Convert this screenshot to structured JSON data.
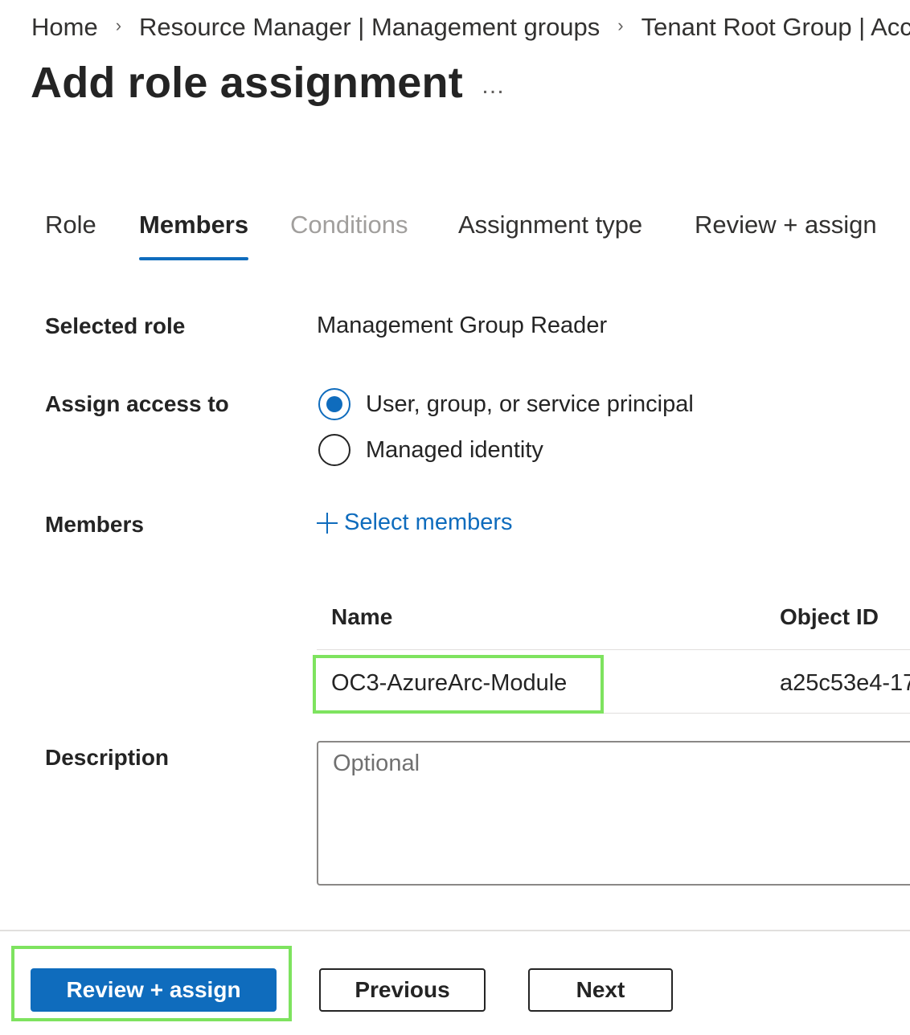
{
  "breadcrumb": {
    "items": [
      "Home",
      "Resource Manager | Management groups",
      "Tenant Root Group | Acc"
    ],
    "separator": "›"
  },
  "header": {
    "title": "Add role assignment",
    "more_label": "…"
  },
  "tabs": [
    {
      "label": "Role",
      "state": "normal"
    },
    {
      "label": "Members",
      "state": "active"
    },
    {
      "label": "Conditions",
      "state": "disabled"
    },
    {
      "label": "Assignment type",
      "state": "normal"
    },
    {
      "label": "Review + assign",
      "state": "normal"
    }
  ],
  "form": {
    "selected_role_label": "Selected role",
    "selected_role_value": "Management Group Reader",
    "assign_access_label": "Assign access to",
    "assign_access_options": [
      {
        "label": "User, group, or service principal",
        "checked": true
      },
      {
        "label": "Managed identity",
        "checked": false
      }
    ],
    "members_label": "Members",
    "select_members_label": "Select members",
    "members_table": {
      "columns": [
        "Name",
        "Object ID"
      ],
      "rows": [
        {
          "name": "OC3-AzureArc-Module",
          "object_id": "a25c53e4-17"
        }
      ]
    },
    "description_label": "Description",
    "description_placeholder": "Optional",
    "description_value": ""
  },
  "footer": {
    "review_assign_label": "Review + assign",
    "previous_label": "Previous",
    "next_label": "Next"
  },
  "colors": {
    "accent": "#0f6cbd",
    "highlight": "#7ee35f"
  }
}
